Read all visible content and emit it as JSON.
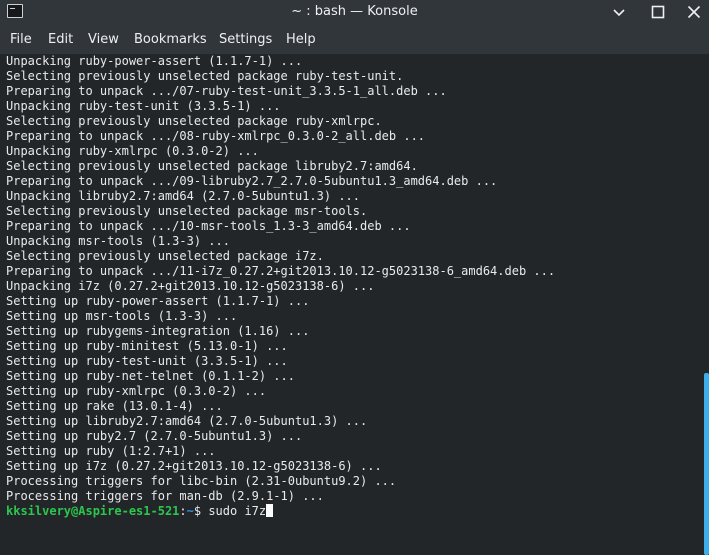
{
  "window": {
    "title": "~ : bash — Konsole",
    "icon": "terminal-icon",
    "buttons": [
      "minimize-icon",
      "maximize-icon",
      "close-icon"
    ]
  },
  "menu": [
    "File",
    "Edit",
    "View",
    "Bookmarks",
    "Settings",
    "Help"
  ],
  "terminal": {
    "lines": [
      "Unpacking ruby-power-assert (1.1.7-1) ...",
      "Selecting previously unselected package ruby-test-unit.",
      "Preparing to unpack .../07-ruby-test-unit_3.3.5-1_all.deb ...",
      "Unpacking ruby-test-unit (3.3.5-1) ...",
      "Selecting previously unselected package ruby-xmlrpc.",
      "Preparing to unpack .../08-ruby-xmlrpc_0.3.0-2_all.deb ...",
      "Unpacking ruby-xmlrpc (0.3.0-2) ...",
      "Selecting previously unselected package libruby2.7:amd64.",
      "Preparing to unpack .../09-libruby2.7_2.7.0-5ubuntu1.3_amd64.deb ...",
      "Unpacking libruby2.7:amd64 (2.7.0-5ubuntu1.3) ...",
      "Selecting previously unselected package msr-tools.",
      "Preparing to unpack .../10-msr-tools_1.3-3_amd64.deb ...",
      "Unpacking msr-tools (1.3-3) ...",
      "Selecting previously unselected package i7z.",
      "Preparing to unpack .../11-i7z_0.27.2+git2013.10.12-g5023138-6_amd64.deb ...",
      "Unpacking i7z (0.27.2+git2013.10.12-g5023138-6) ...",
      "Setting up ruby-power-assert (1.1.7-1) ...",
      "Setting up msr-tools (1.3-3) ...",
      "Setting up rubygems-integration (1.16) ...",
      "Setting up ruby-minitest (5.13.0-1) ...",
      "Setting up ruby-test-unit (3.3.5-1) ...",
      "Setting up ruby-net-telnet (0.1.1-2) ...",
      "Setting up ruby-xmlrpc (0.3.0-2) ...",
      "Setting up rake (13.0.1-4) ...",
      "Setting up libruby2.7:amd64 (2.7.0-5ubuntu1.3) ...",
      "Setting up ruby2.7 (2.7.0-5ubuntu1.3) ...",
      "Setting up ruby (1:2.7+1) ...",
      "Setting up i7z (0.27.2+git2013.10.12-g5023138-6) ...",
      "Processing triggers for libc-bin (2.31-0ubuntu9.2) ...",
      "Processing triggers for man-db (2.9.1-1) ..."
    ],
    "prompt": {
      "user_host": "kksilvery@Aspire-es1-521",
      "separator": ":",
      "path": "~",
      "symbol": "$",
      "command": " sudo i7z"
    }
  },
  "colors": {
    "background": "#232629",
    "chrome": "#31363b",
    "text": "#e8eaeb",
    "prompt_user": "#2cc64e",
    "prompt_path": "#2f8fe0",
    "scrollbar": "#3daee9"
  }
}
